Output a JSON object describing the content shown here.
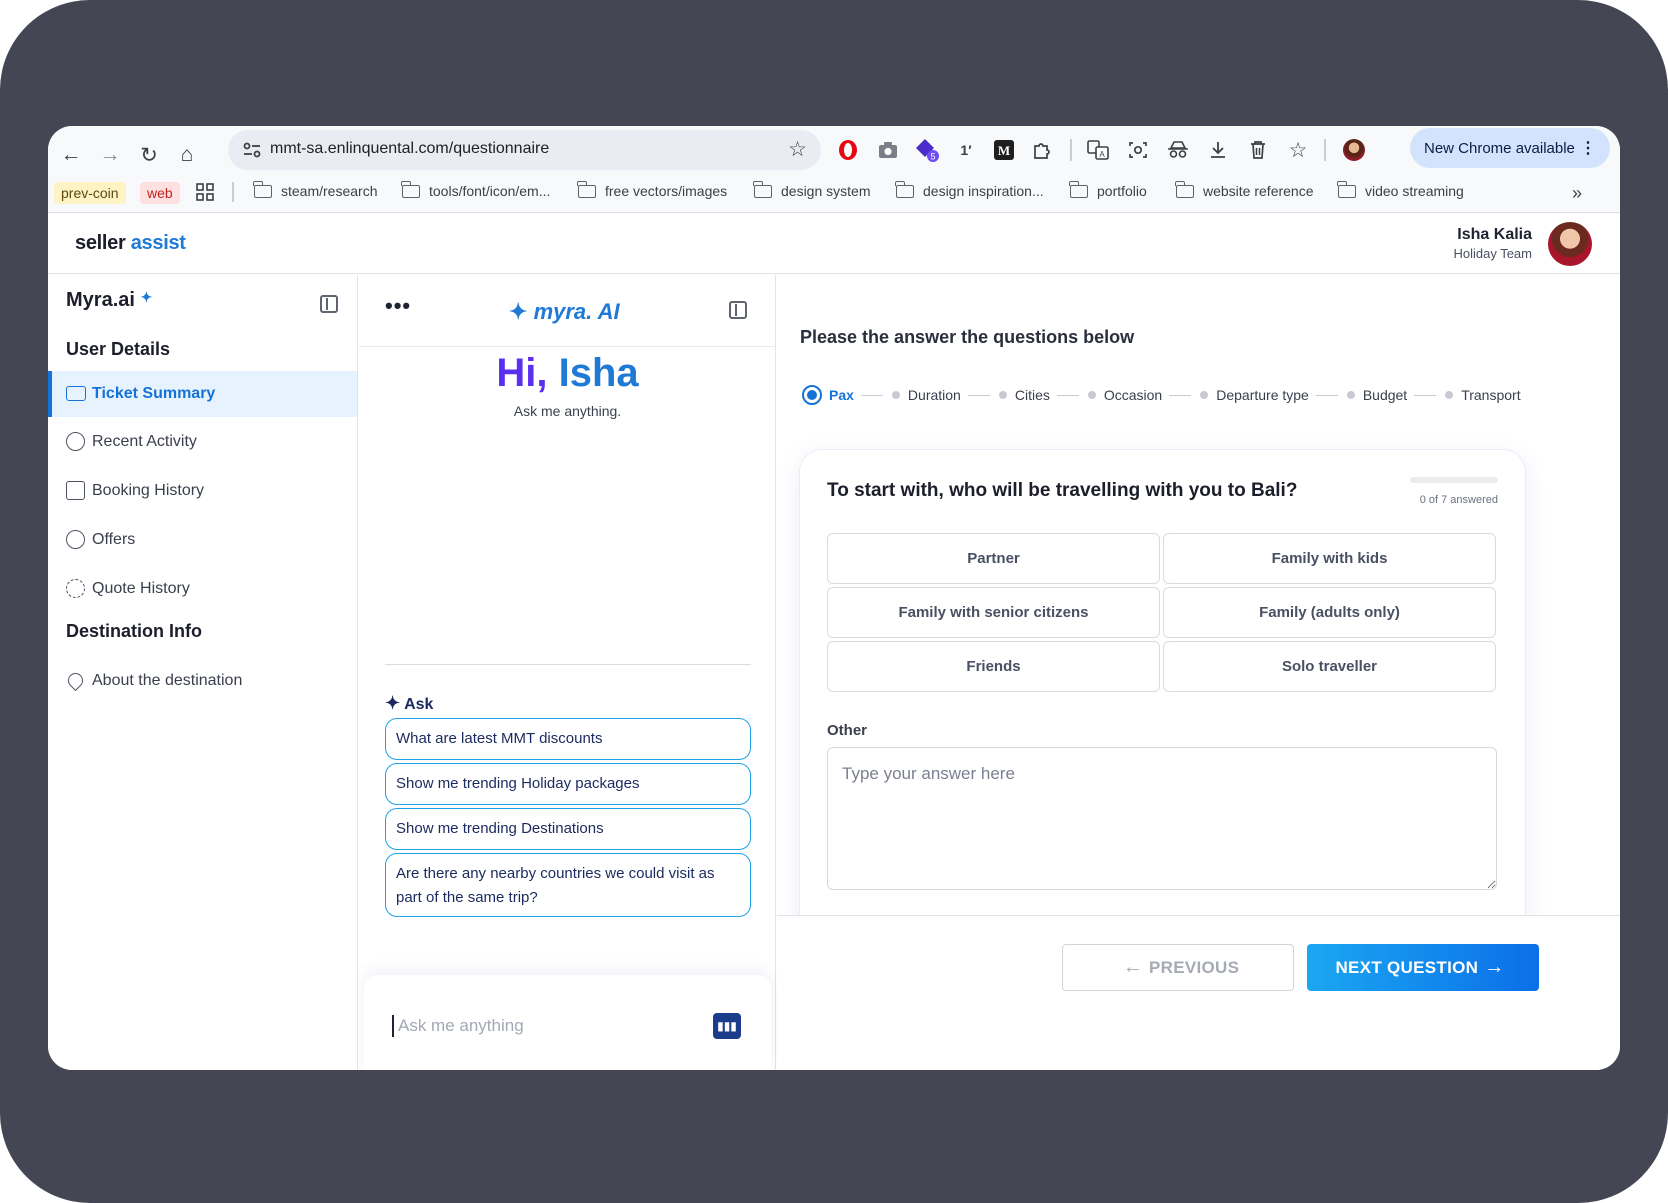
{
  "browser": {
    "url": "mmt-sa.enlinquental.com/questionnaire",
    "update_chip": "New Chrome available",
    "ext_badge": "5",
    "ext_text": "1′",
    "bookmark_chips": [
      {
        "label": "prev-coin",
        "bg": "#fdf3c4",
        "color": "#5b4a10"
      },
      {
        "label": "web",
        "bg": "#fde0e0",
        "color": "#c5221f"
      }
    ],
    "bookmarks": [
      "steam/research",
      "tools/font/icon/em...",
      "free vectors/images",
      "design system",
      "design inspiration...",
      "portfolio",
      "website reference",
      "video streaming"
    ]
  },
  "app": {
    "logo_prefix": "seller",
    "logo_accent": "assist",
    "user_name": "Isha Kalia",
    "user_team": "Holiday Team"
  },
  "sidebar": {
    "brand": "Myra.ai",
    "section_user": "User Details",
    "items": [
      {
        "label": "Ticket Summary",
        "icon": "ticket-icon",
        "active": true
      },
      {
        "label": "Recent Activity",
        "icon": "history-icon",
        "active": false
      },
      {
        "label": "Booking History",
        "icon": "calendar-icon",
        "active": false
      },
      {
        "label": "Offers",
        "icon": "discount-icon",
        "active": false
      },
      {
        "label": "Quote History",
        "icon": "quote-history-icon",
        "active": false
      }
    ],
    "section_destination": "Destination Info",
    "destination_items": [
      {
        "label": "About the destination",
        "icon": "location-pin-icon"
      }
    ]
  },
  "chat": {
    "brand": "myra. AI",
    "greeting_hi": "Hi,",
    "greeting_name": "Isha",
    "greeting_sub": "Ask me anything.",
    "ask_label": "Ask",
    "suggestions": [
      "What are latest MMT discounts",
      "Show me trending Holiday packages",
      "Show me trending Destinations",
      "Are there any nearby countries we could visit as part of the same trip?"
    ],
    "input_placeholder": "Ask me anything"
  },
  "quiz": {
    "title": "Please the answer the questions below",
    "steps": [
      "Pax",
      "Duration",
      "Cities",
      "Occasion",
      "Departure type",
      "Budget",
      "Transport"
    ],
    "active_step": 0,
    "question": "To start with, who will be travelling with you to Bali?",
    "answered_text": "0 of 7 answered",
    "answered_fraction": 0,
    "options": [
      "Partner",
      "Family with kids",
      "Family with senior citizens",
      "Family (adults only)",
      "Friends",
      "Solo traveller"
    ],
    "other_label": "Other",
    "other_placeholder": "Type your answer here",
    "prev_label": "PREVIOUS",
    "next_label": "NEXT QUESTION"
  },
  "colors": {
    "accent": "#1572d8",
    "brand_purple": "#5b2ff0",
    "next_gradient_start": "#1ba7f2",
    "next_gradient_end": "#0b6fe8"
  }
}
